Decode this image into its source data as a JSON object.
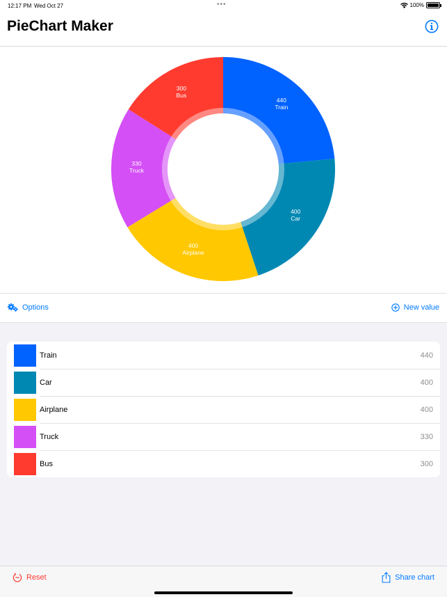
{
  "status_bar": {
    "time": "12:17 PM",
    "date": "Wed Oct 27",
    "battery": "100%",
    "icons": [
      "wifi-icon",
      "battery-icon"
    ]
  },
  "nav": {
    "title": "PieChart Maker",
    "info_icon": "info-icon"
  },
  "chart_data": {
    "type": "pie",
    "style": "donut",
    "categories": [
      "Train",
      "Car",
      "Airplane",
      "Truck",
      "Bus"
    ],
    "values": [
      440,
      400,
      400,
      330,
      300
    ],
    "colors": [
      "#0062ff",
      "#0088b3",
      "#ffc800",
      "#d44ff5",
      "#ff3b30"
    ],
    "data_labels": [
      "440\nTrain",
      "400\nCar",
      "400\nAirplane",
      "330\nTruck",
      "300\nBus"
    ],
    "start_angle": "top",
    "direction": "clockwise"
  },
  "actions": {
    "options_label": "Options",
    "options_icon": "gears-icon",
    "new_value_label": "New value",
    "new_value_icon": "plus-circle-icon"
  },
  "list": {
    "items": [
      {
        "label": "Train",
        "value": "440",
        "color": "#0062ff"
      },
      {
        "label": "Car",
        "value": "400",
        "color": "#0088b3"
      },
      {
        "label": "Airplane",
        "value": "400",
        "color": "#ffc800"
      },
      {
        "label": "Truck",
        "value": "330",
        "color": "#d44ff5"
      },
      {
        "label": "Bus",
        "value": "300",
        "color": "#ff3b30"
      }
    ]
  },
  "toolbar": {
    "reset_label": "Reset",
    "reset_icon": "reset-icon",
    "share_label": "Share chart",
    "share_icon": "share-icon"
  }
}
